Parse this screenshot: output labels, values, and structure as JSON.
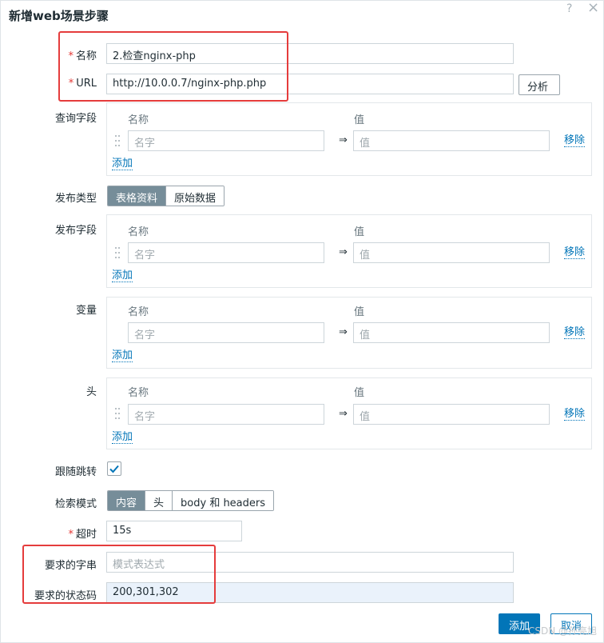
{
  "dialog": {
    "title": "新增web场景步骤",
    "help": "?",
    "close": "×"
  },
  "fields": {
    "name": {
      "label": "名称",
      "value": "2.检查nginx-php"
    },
    "url": {
      "label": "URL",
      "value": "http://10.0.0.7/nginx-php.php",
      "parse_label": "分析"
    },
    "query": {
      "label": "查询字段"
    },
    "post_type": {
      "label": "发布类型",
      "options": [
        "表格资料",
        "原始数据"
      ],
      "selected": "表格资料"
    },
    "post_fields": {
      "label": "发布字段"
    },
    "variables": {
      "label": "变量"
    },
    "headers": {
      "label": "头"
    },
    "follow_redirects": {
      "label": "跟随跳转",
      "checked": true
    },
    "retrieve_mode": {
      "label": "检索模式",
      "options": [
        "内容",
        "头",
        "body 和 headers"
      ],
      "selected": "内容"
    },
    "timeout": {
      "label": "超时",
      "value": "15s"
    },
    "required_string": {
      "label": "要求的字串",
      "placeholder": "模式表达式"
    },
    "status_codes": {
      "label": "要求的状态码",
      "value": "200,301,302"
    }
  },
  "pair_table": {
    "col_name": "名称",
    "col_value": "值",
    "name_placeholder": "名字",
    "value_placeholder": "值",
    "remove_label": "移除",
    "add_label": "添加"
  },
  "footer": {
    "add_label": "添加",
    "cancel_label": "取消"
  },
  "watermark": "CSDN @孙亮旭",
  "colors": {
    "accent": "#0275b8",
    "highlight": "#e53c3c",
    "segment_selected": "#768d99"
  }
}
